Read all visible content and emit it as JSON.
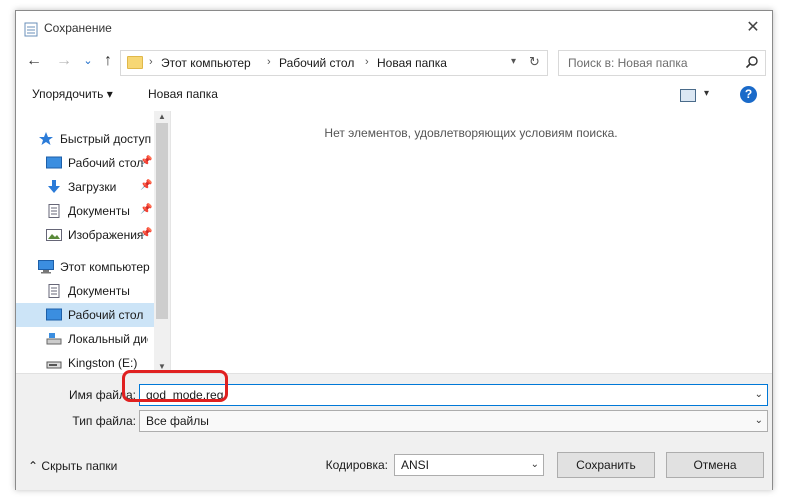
{
  "window": {
    "title": "Сохранение",
    "close_glyph": "✕"
  },
  "nav": {
    "back_glyph": "←",
    "forward_glyph": "→",
    "recent_glyph": "⌄",
    "up_glyph": "↑",
    "breadcrumbs": [
      "Этот компьютер",
      "Рабочий стол",
      "Новая папка"
    ],
    "search_placeholder": "Поиск в: Новая папка"
  },
  "toolbar": {
    "organize_label": "Упорядочить ▾",
    "new_folder_label": "Новая папка",
    "help_label": "?"
  },
  "sidebar": {
    "items": [
      {
        "label": "Быстрый доступ",
        "icon": "star-icon",
        "pinned": false
      },
      {
        "label": "Рабочий стол",
        "icon": "desktop-icon",
        "pinned": true
      },
      {
        "label": "Загрузки",
        "icon": "download-icon",
        "pinned": true
      },
      {
        "label": "Документы",
        "icon": "document-icon",
        "pinned": true
      },
      {
        "label": "Изображения",
        "icon": "pictures-icon",
        "pinned": true
      },
      {
        "label": "Этот компьютер",
        "icon": "computer-icon",
        "pinned": false
      },
      {
        "label": "Документы",
        "icon": "document-icon",
        "pinned": false
      },
      {
        "label": "Рабочий стол",
        "icon": "desktop-icon",
        "pinned": false,
        "selected": true
      },
      {
        "label": "Локальный диск",
        "icon": "drive-icon",
        "pinned": false
      },
      {
        "label": "Kingston (E:)",
        "icon": "usb-drive-icon",
        "pinned": false
      }
    ]
  },
  "content": {
    "empty_message": "Нет элементов, удовлетворяющих условиям поиска."
  },
  "form": {
    "filename_label": "Имя файла:",
    "filename_value": "god_mode.reg",
    "filetype_label": "Тип файла:",
    "filetype_value": "Все файлы",
    "encoding_label": "Кодировка:",
    "encoding_value": "ANSI",
    "hide_folders_label": "Скрыть папки",
    "save_label": "Сохранить",
    "cancel_label": "Отмена"
  },
  "colors": {
    "accent": "#0078d7",
    "highlight": "#e02020",
    "selected_bg": "#cce4f7"
  }
}
